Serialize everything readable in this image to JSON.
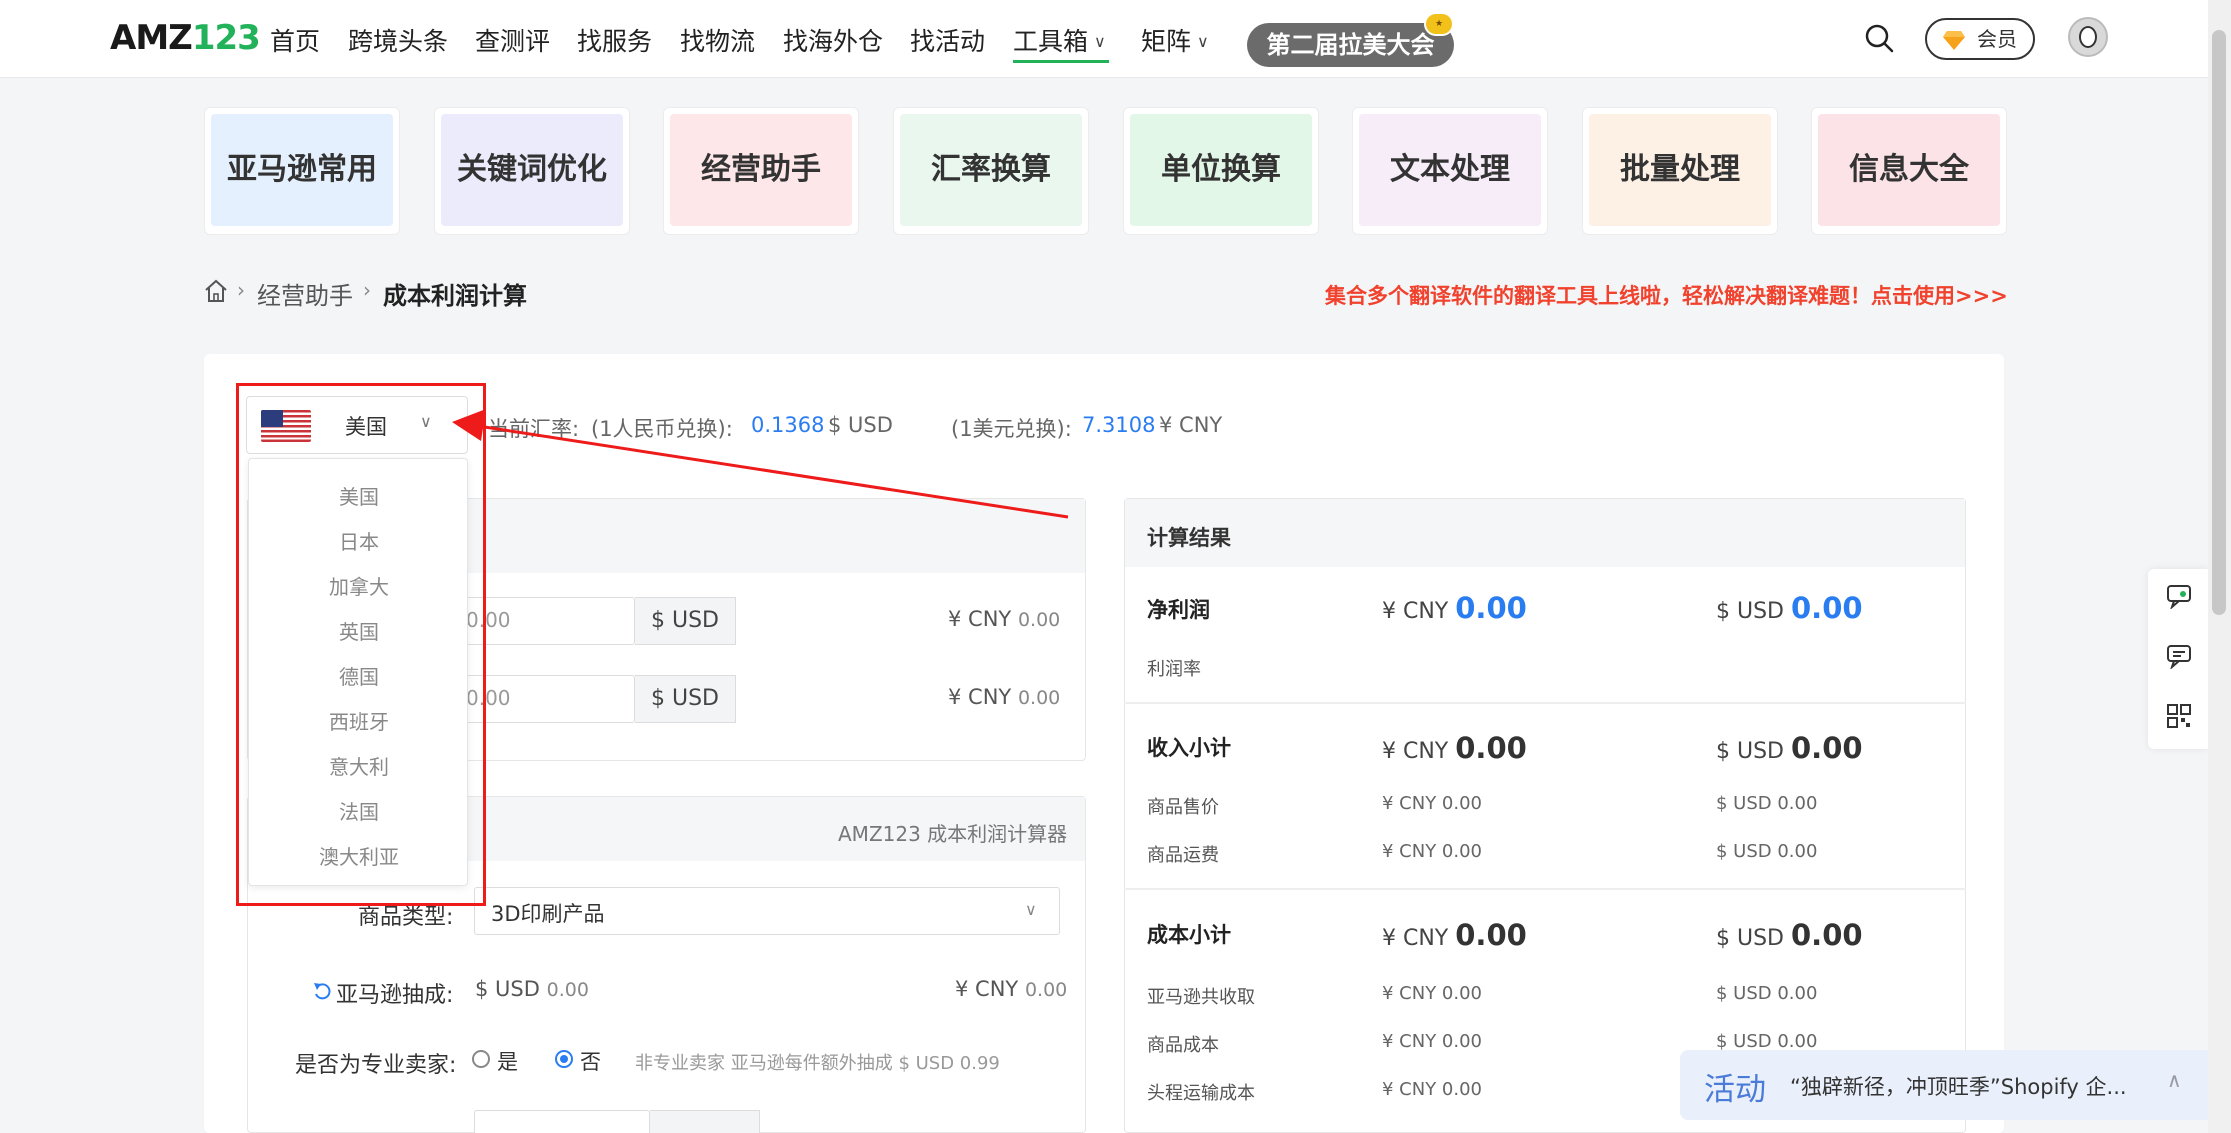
{
  "header": {
    "logo_part1": "AMZ",
    "logo_part2": "123",
    "nav": [
      "首页",
      "跨境头条",
      "查测评",
      "找服务",
      "找物流",
      "找海外仓",
      "找活动",
      "工具箱",
      "矩阵"
    ],
    "active_nav": "工具箱",
    "event_label": "第二届拉美大会",
    "member_label": "会员"
  },
  "tiles": [
    {
      "label": "亚马逊常用",
      "bg": "#e4f0fd"
    },
    {
      "label": "关键词优化",
      "bg": "#ecebfc"
    },
    {
      "label": "经营助手",
      "bg": "#fde7e9"
    },
    {
      "label": "汇率换算",
      "bg": "#eaf7ee"
    },
    {
      "label": "单位换算",
      "bg": "#e3f7e9"
    },
    {
      "label": "文本处理",
      "bg": "#f6edf8"
    },
    {
      "label": "批量处理",
      "bg": "#fdf0e4"
    },
    {
      "label": "信息大全",
      "bg": "#fce3e7"
    }
  ],
  "breadcrumb": {
    "level1": "经营助手",
    "current": "成本利润计算"
  },
  "promo_text": "集合多个翻译软件的翻译工具上线啦，轻松解决翻译难题！点击使用>>>",
  "country": {
    "selected": "美国",
    "options": [
      "美国",
      "日本",
      "加拿大",
      "英国",
      "德国",
      "西班牙",
      "意大利",
      "法国",
      "澳大利亚"
    ]
  },
  "exchange": {
    "label": "当前汇率:",
    "cny_label": "(1人民币兑换):",
    "cny_rate": "0.1368",
    "cny_unit": "$ USD",
    "usd_label": "(1美元兑换):",
    "usd_rate": "7.3108",
    "usd_unit": "¥ CNY"
  },
  "inputs": {
    "row1": {
      "value": "0.00",
      "unit": "$ USD",
      "cny_prefix": "¥ CNY",
      "cny_value": "0.00"
    },
    "row2": {
      "value": "0.00",
      "unit": "$ USD",
      "cny_prefix": "¥ CNY",
      "cny_value": "0.00"
    },
    "calc_label": "AMZ123 成本利润计算器",
    "product_type_label": "商品类型:",
    "product_type_value": "3D印刷产品",
    "commission_label": "亚马逊抽成:",
    "commission_usd_prefix": "$ USD",
    "commission_usd": "0.00",
    "commission_cny_prefix": "¥ CNY",
    "commission_cny": "0.00",
    "pro_seller_label": "是否为专业卖家:",
    "radio_yes": "是",
    "radio_no": "否",
    "pro_note": "非专业卖家 亚马逊每件额外抽成 $ USD 0.99"
  },
  "results": {
    "title": "计算结果",
    "net_profit": {
      "label": "净利润",
      "cny_prefix": "¥ CNY",
      "cny": "0.00",
      "usd_prefix": "$ USD",
      "usd": "0.00"
    },
    "profit_rate_label": "利润率",
    "income": {
      "label": "收入小计",
      "cny_prefix": "¥ CNY",
      "cny": "0.00",
      "usd_prefix": "$ USD",
      "usd": "0.00",
      "rows": [
        {
          "label": "商品售价",
          "cny": "¥ CNY 0.00",
          "usd": "$ USD 0.00"
        },
        {
          "label": "商品运费",
          "cny": "¥ CNY 0.00",
          "usd": "$ USD 0.00"
        }
      ]
    },
    "cost": {
      "label": "成本小计",
      "cny_prefix": "¥ CNY",
      "cny": "0.00",
      "usd_prefix": "$ USD",
      "usd": "0.00",
      "rows": [
        {
          "label": "亚马逊共收取",
          "cny": "¥ CNY 0.00",
          "usd": "$ USD 0.00"
        },
        {
          "label": "商品成本",
          "cny": "¥ CNY 0.00",
          "usd": "$ USD 0.00"
        },
        {
          "label": "头程运输成本",
          "cny": "¥ CNY 0.00",
          "usd": ""
        }
      ]
    }
  },
  "toast": {
    "tag": "活动",
    "text": "“独辟新径，冲顶旺季”Shopify 企..."
  },
  "colors": {
    "brand_green": "#22b25a",
    "link_blue": "#2a7df1",
    "promo_red": "#f0422d",
    "annotation_red": "#ee1b1b"
  }
}
